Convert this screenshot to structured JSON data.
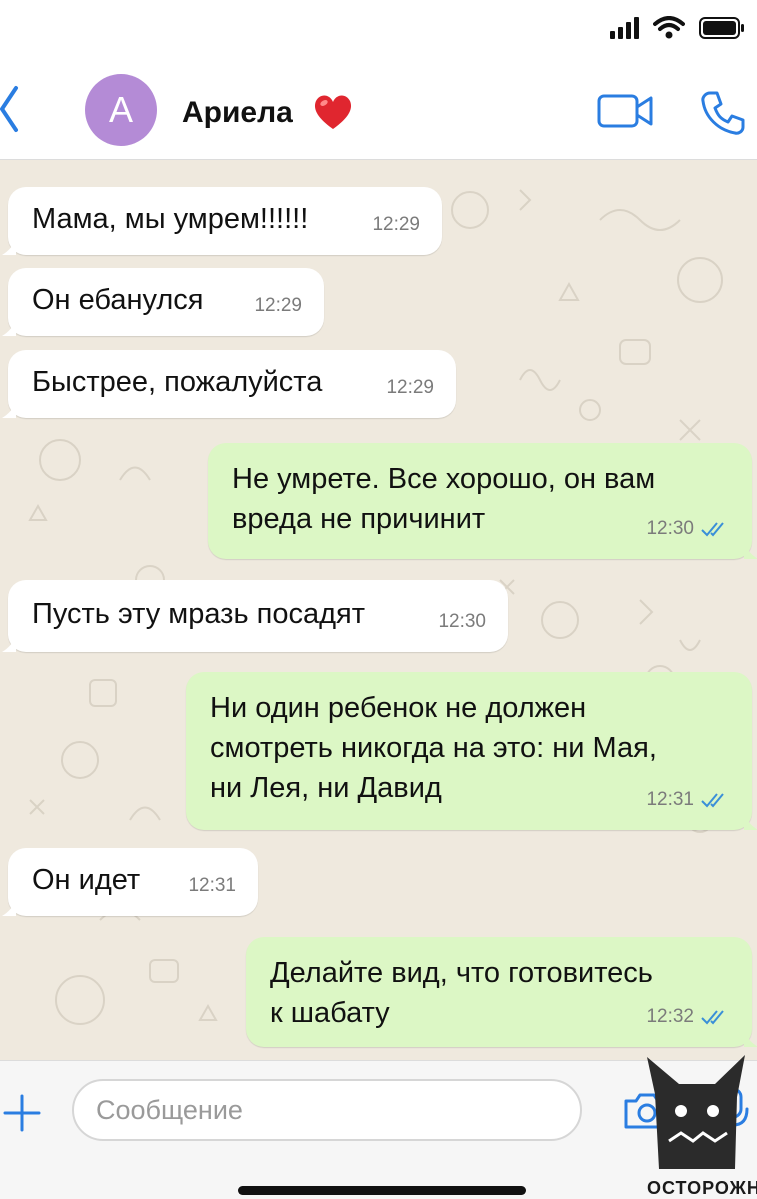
{
  "header": {
    "avatar_letter": "A",
    "contact_name": "Ариела",
    "heart_emoji": "❤️"
  },
  "messages": [
    {
      "direction": "in",
      "text": "Мама, мы умрем!!!!!!",
      "time": "12:29"
    },
    {
      "direction": "in",
      "text": "Он ебанулся",
      "time": "12:29"
    },
    {
      "direction": "in",
      "text": "Быстрее, пожалуйста",
      "time": "12:29"
    },
    {
      "direction": "out",
      "text": "Не умрете. Все хорошо, он вам\nвреда не причинит",
      "time": "12:30",
      "status": "read"
    },
    {
      "direction": "in",
      "text": "Пусть эту мразь посадят",
      "time": "12:30"
    },
    {
      "direction": "out",
      "text": "Ни один ребенок не должен\nсмотреть никогда на это: ни Мая,\nни Лея, ни Давид",
      "time": "12:31",
      "status": "read"
    },
    {
      "direction": "in",
      "text": "Он идет",
      "time": "12:31"
    },
    {
      "direction": "out",
      "text": "Делайте вид, что готовитесь\nк шабату",
      "time": "12:32",
      "status": "read"
    }
  ],
  "input": {
    "placeholder": "Сообщение"
  },
  "watermark": {
    "text": "ОСТОРОЖН"
  },
  "icons": {
    "back": "chevron-left-icon",
    "video": "video-camera-icon",
    "call": "phone-icon",
    "plus": "plus-icon",
    "camera": "camera-icon",
    "mic": "microphone-icon",
    "read_ticks": "double-check-icon"
  },
  "colors": {
    "accent": "#2a7de1",
    "incoming_bubble": "#ffffff",
    "outgoing_bubble": "#dcf7c5",
    "chat_background": "#efe9de",
    "avatar": "#b48bd6",
    "read_ticks": "#3a8fd8"
  }
}
